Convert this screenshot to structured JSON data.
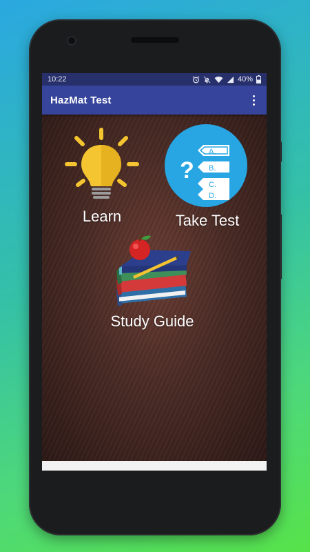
{
  "status_bar": {
    "time": "10:22",
    "battery": "40%",
    "icons": [
      "alarm-icon",
      "mute-icon",
      "wifi-icon",
      "signal-icon",
      "battery-icon"
    ]
  },
  "app_bar": {
    "title": "HazMat Test",
    "menu_icon": "overflow-menu-icon"
  },
  "menu": {
    "learn": {
      "label": "Learn",
      "icon": "lightbulb-icon"
    },
    "take_test": {
      "label": "Take Test",
      "icon": "quiz-icon",
      "options": [
        "A.",
        "B.",
        "C.",
        "D."
      ],
      "question_mark": "?"
    },
    "study_guide": {
      "label": "Study Guide",
      "icon": "books-apple-icon"
    }
  },
  "colors": {
    "status_bar": "#27306b",
    "app_bar": "#37449b",
    "quiz_circle": "#27a6e3",
    "bulb": "#f4c531"
  }
}
